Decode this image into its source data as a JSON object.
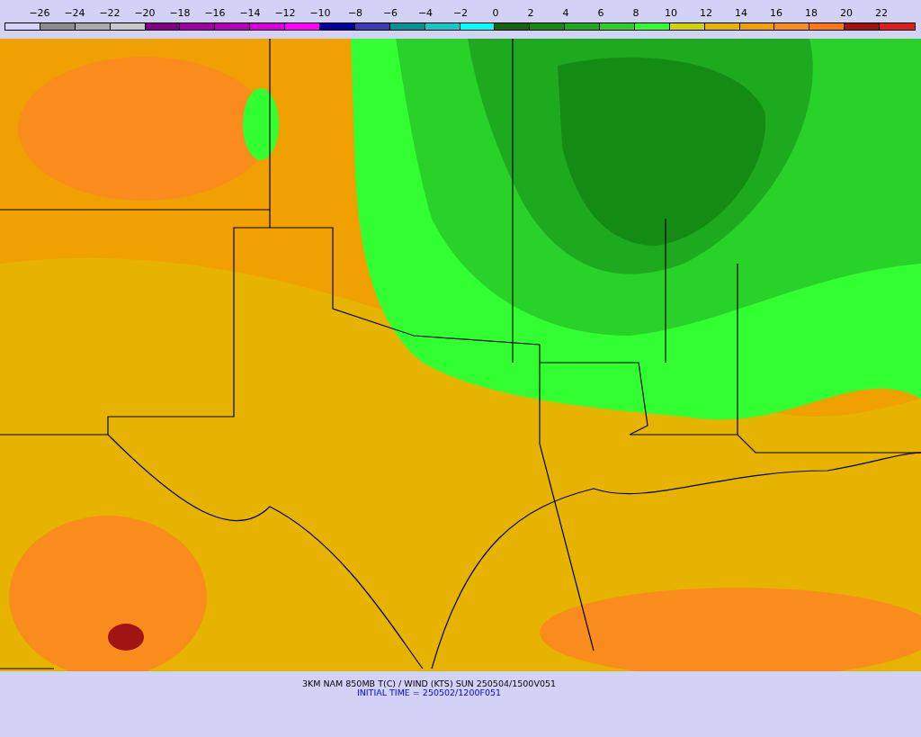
{
  "legend": {
    "labels": [
      "−26",
      "−24",
      "−22",
      "−20",
      "−18",
      "−16",
      "−14",
      "−12",
      "−10",
      "−8",
      "−6",
      "−4",
      "−2",
      "0",
      "2",
      "4",
      "6",
      "8",
      "10",
      "12",
      "14",
      "16",
      "18",
      "20",
      "22"
    ],
    "swatches": [
      {
        "color": "#d4d4f8"
      },
      {
        "color": "#8c8c8c"
      },
      {
        "color": "#aaaaaa"
      },
      {
        "color": "#c8c8c8"
      },
      {
        "color": "#800080"
      },
      {
        "color": "#a000a0"
      },
      {
        "color": "#b800b8"
      },
      {
        "color": "#d800d8"
      },
      {
        "color": "#ff00ff"
      },
      {
        "color": "#000098"
      },
      {
        "color": "#3c3cb0"
      },
      {
        "color": "#009494"
      },
      {
        "color": "#14c8c8"
      },
      {
        "color": "#00ffff"
      },
      {
        "color": "#146414"
      },
      {
        "color": "#148c14"
      },
      {
        "color": "#1eaa1e"
      },
      {
        "color": "#28d228"
      },
      {
        "color": "#32ff32"
      },
      {
        "color": "#d2d200"
      },
      {
        "color": "#e6b400"
      },
      {
        "color": "#f0a000"
      },
      {
        "color": "#fa8c1e"
      },
      {
        "color": "#ff7814"
      },
      {
        "color": "#a01414"
      },
      {
        "color": "#dc1e1e"
      }
    ]
  },
  "caption": {
    "title": "3KM NAM 850MB T(C) / WIND (KTS) SUN 250504/1500V051",
    "initial_time": "INITIAL TIME = 250502/1200F051"
  }
}
